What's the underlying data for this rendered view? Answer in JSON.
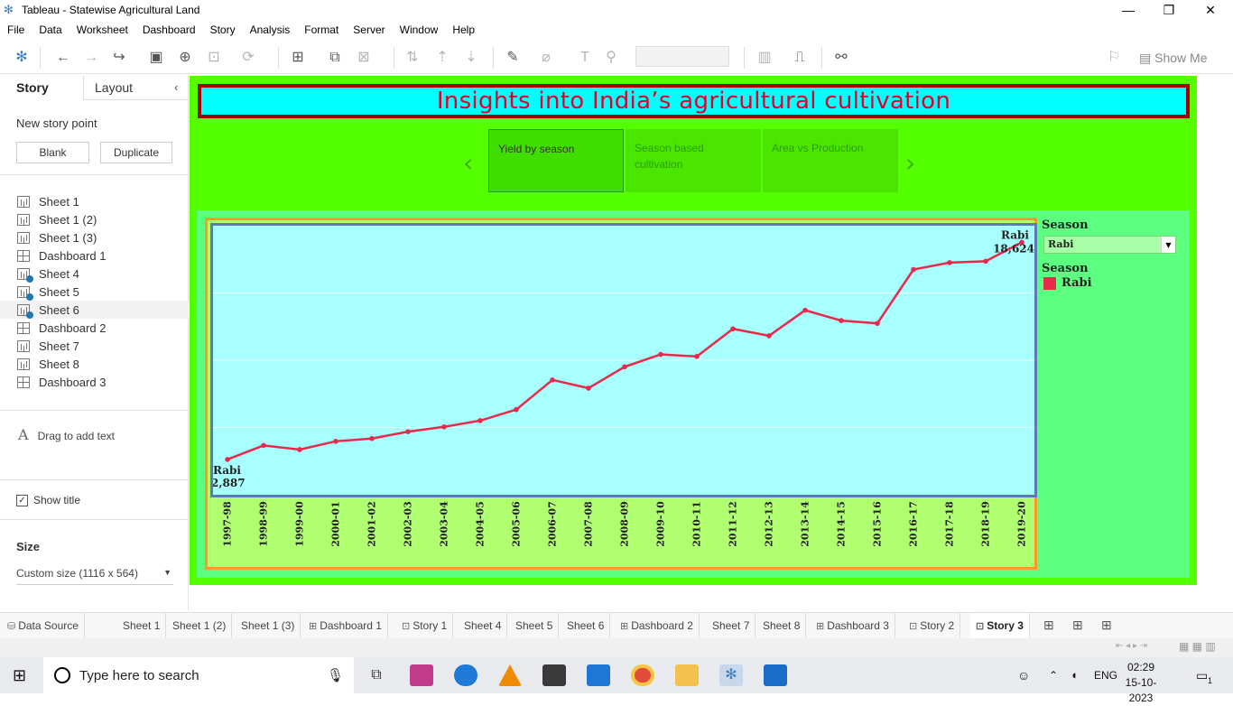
{
  "window": {
    "title": "Tableau - Statewise Agricultural Land"
  },
  "menu": [
    "File",
    "Data",
    "Worksheet",
    "Dashboard",
    "Story",
    "Analysis",
    "Format",
    "Server",
    "Window",
    "Help"
  ],
  "toolbar": {
    "show_me": "Show Me"
  },
  "left_pane": {
    "tabs": [
      "Story",
      "Layout"
    ],
    "new_story_point": "New story point",
    "blank": "Blank",
    "duplicate": "Duplicate",
    "sheets": [
      {
        "label": "Sheet 1",
        "kind": "sheet",
        "check": false
      },
      {
        "label": "Sheet 1 (2)",
        "kind": "sheet",
        "check": false
      },
      {
        "label": "Sheet 1 (3)",
        "kind": "sheet",
        "check": false
      },
      {
        "label": "Dashboard 1",
        "kind": "dashboard",
        "check": false
      },
      {
        "label": "Sheet 4",
        "kind": "sheet",
        "check": true
      },
      {
        "label": "Sheet 5",
        "kind": "sheet",
        "check": true
      },
      {
        "label": "Sheet 6",
        "kind": "sheet",
        "check": true
      },
      {
        "label": "Dashboard 2",
        "kind": "dashboard",
        "check": false
      },
      {
        "label": "Sheet 7",
        "kind": "sheet",
        "check": false
      },
      {
        "label": "Sheet 8",
        "kind": "sheet",
        "check": false
      },
      {
        "label": "Dashboard 3",
        "kind": "dashboard",
        "check": false
      }
    ],
    "drag_to_add_text": "Drag to add text",
    "show_title": "Show title",
    "size_heading": "Size",
    "size_value": "Custom size (1116 x 564)"
  },
  "story": {
    "title": "Insights into India’s agricultural cultivation",
    "points": [
      "Yield by season",
      "Season based cultivation",
      "Area vs Production"
    ],
    "active_point": 0
  },
  "legend": {
    "filter_heading": "Season",
    "filter_value": "Rabi",
    "color_heading": "Season",
    "color_item": "Rabi",
    "color": "#e8294a"
  },
  "chart_data": {
    "type": "line",
    "x": [
      "1997-98",
      "1998-99",
      "1999-00",
      "2000-01",
      "2001-02",
      "2002-03",
      "2003-04",
      "2004-05",
      "2005-06",
      "2006-07",
      "2007-08",
      "2008-09",
      "2009-10",
      "2010-11",
      "2011-12",
      "2012-13",
      "2013-14",
      "2014-15",
      "2015-16",
      "2016-17",
      "2017-18",
      "2018-19",
      "2019-20"
    ],
    "series": [
      {
        "name": "Rabi",
        "values": [
          2887,
          3900,
          3600,
          4200,
          4400,
          4900,
          5250,
          5700,
          6500,
          8650,
          8050,
          9600,
          10500,
          10350,
          12350,
          11850,
          13700,
          12950,
          12750,
          16650,
          17150,
          17250,
          18624
        ]
      }
    ],
    "start_label": {
      "season": "Rabi",
      "value": "2,887"
    },
    "end_label": {
      "season": "Rabi",
      "value": "18,624"
    },
    "ylim": [
      0,
      19500
    ],
    "grid": true
  },
  "bottom_tabs": [
    {
      "label": "Data Source",
      "icon": "data-source"
    },
    {
      "label": "Sheet 1",
      "icon": ""
    },
    {
      "label": "Sheet 1 (2)",
      "icon": ""
    },
    {
      "label": "Sheet 1 (3)",
      "icon": ""
    },
    {
      "label": "Dashboard 1",
      "icon": "dashboard"
    },
    {
      "label": "Story 1",
      "icon": "story"
    },
    {
      "label": "Sheet 4",
      "icon": ""
    },
    {
      "label": "Sheet 5",
      "icon": ""
    },
    {
      "label": "Sheet 6",
      "icon": ""
    },
    {
      "label": "Dashboard 2",
      "icon": "dashboard"
    },
    {
      "label": "Sheet 7",
      "icon": ""
    },
    {
      "label": "Sheet 8",
      "icon": ""
    },
    {
      "label": "Dashboard 3",
      "icon": "dashboard"
    },
    {
      "label": "Story 2",
      "icon": "story"
    },
    {
      "label": "Story 3",
      "icon": "story",
      "active": true
    }
  ],
  "taskbar": {
    "search_placeholder": "Type here to search",
    "lang": "ENG",
    "time": "02:29",
    "date": "15-10-2023",
    "notifications": "1"
  }
}
